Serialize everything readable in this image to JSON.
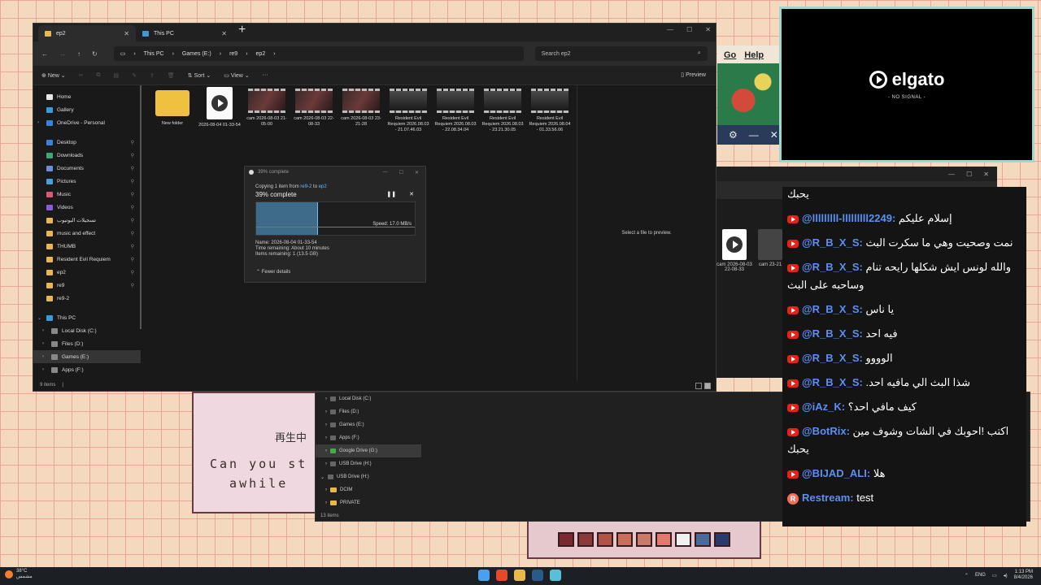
{
  "explorer": {
    "tabs": [
      {
        "label": "ep2",
        "close": "✕"
      },
      {
        "label": "This PC",
        "close": "✕"
      }
    ],
    "new_tab": "+",
    "window_controls": [
      "—",
      "☐",
      "✕"
    ],
    "breadcrumb": [
      "This PC",
      "Games (E:)",
      "re9",
      "ep2"
    ],
    "search_placeholder": "Search ep2",
    "toolbar": {
      "new": "New",
      "sort": "Sort",
      "view": "View",
      "more": "···",
      "preview": "Preview"
    },
    "nav": {
      "home": "Home",
      "gallery": "Gallery",
      "onedrive": "OneDrive - Personal",
      "quick": [
        {
          "label": "Desktop",
          "color": "#3b82d6"
        },
        {
          "label": "Downloads",
          "color": "#3aa87a"
        },
        {
          "label": "Documents",
          "color": "#6d8fd8"
        },
        {
          "label": "Pictures",
          "color": "#4a9fd8"
        },
        {
          "label": "Music",
          "color": "#e0567a"
        },
        {
          "label": "Videos",
          "color": "#8a5ad8"
        },
        {
          "label": "تسجيلات اليوتيوب",
          "color": "#e8b84a"
        },
        {
          "label": "music and effect",
          "color": "#e8b84a"
        },
        {
          "label": "THUMB",
          "color": "#e8b84a"
        },
        {
          "label": "Resident Evil Requiem",
          "color": "#e8b84a"
        },
        {
          "label": "ep2",
          "color": "#e8b84a"
        },
        {
          "label": "re9",
          "color": "#e8b84a"
        },
        {
          "label": "re9-2",
          "color": "#e8b84a"
        }
      ],
      "this_pc": "This PC",
      "drives": [
        "Local Disk (C:)",
        "Files (D:)",
        "Games (E:)",
        "Apps (F:)"
      ]
    },
    "files": [
      {
        "name": "New folder",
        "kind": "folder"
      },
      {
        "name": "2026-08-04 01-33-54",
        "kind": "video-doc"
      },
      {
        "name": "cam 2026-08-03 21-05-00",
        "kind": "face"
      },
      {
        "name": "cam 2026-08-03 22-08-33",
        "kind": "face"
      },
      {
        "name": "cam 2026-08-03 23-21-28",
        "kind": "face"
      },
      {
        "name": "Resident Evil Requiem 2026.08.03 - 21.07.46.03",
        "kind": "dark"
      },
      {
        "name": "Resident Evil Requiem 2026.08.03 - 22.08.34.04",
        "kind": "dark"
      },
      {
        "name": "Resident Evil Requiem 2026.08.03 - 23.21.30.05",
        "kind": "dark"
      },
      {
        "name": "Resident Evil Requiem 2026.08.04 - 01.33.56.06",
        "kind": "dark"
      }
    ],
    "preview_text": "Select a file to preview.",
    "status": "9 items"
  },
  "copy_dialog": {
    "title": "39% complete",
    "copying_prefix": "Copying 1 item from ",
    "from": "re9-2",
    "to_word": " to ",
    "to": "ep2",
    "percent_label": "39% complete",
    "progress": 0.39,
    "pause": "❚❚",
    "cancel": "✕",
    "speed": "Speed: 17.0 MB/s",
    "name": "Name: 2026-08-04 01-33-54",
    "time": "Time remaining:  About 10 minutes",
    "items": "Items remaining:  1 (13.5 GB)",
    "fewer": "Fewer details"
  },
  "explorer2": {
    "tree": [
      "Local Disk (C:)",
      "Files (D:)",
      "Games (E:)",
      "Apps (F:)",
      "Google Drive (G:)",
      "USB Drive (H:)",
      "USB Drive (H:)",
      "DCIM",
      "PRIVATE"
    ],
    "count": "13 items"
  },
  "right_files": [
    {
      "name": "cam 2026-08-03 22-08-33"
    },
    {
      "name": "cam 23-21"
    }
  ],
  "game": {
    "line1": "Can you st",
    "line2": "  awhile",
    "menu": [
      "Go",
      "Help"
    ],
    "kanji": "再生中"
  },
  "elgato": {
    "brand": "elgato",
    "status": "- NO SIGNAL -"
  },
  "chat": [
    {
      "src": "yt",
      "user": "",
      "text": "يحبك",
      "partial": true
    },
    {
      "src": "yt",
      "user": "@lllllllll-lllllllll2249:",
      "text": "إسلام عليكم"
    },
    {
      "src": "yt",
      "user": "@R_B_X_S:",
      "text": "نمت وصحيت وهي ما سكرت البث"
    },
    {
      "src": "yt",
      "user": "@R_B_X_S:",
      "text": "والله لونس ايش شكلها رايحه تنام",
      "text2": "وساحبه على البث"
    },
    {
      "src": "yt",
      "user": "@R_B_X_S:",
      "text": "يا ناس"
    },
    {
      "src": "yt",
      "user": "@R_B_X_S:",
      "text": "فيه احد"
    },
    {
      "src": "yt",
      "user": "@R_B_X_S:",
      "text": "الوووو"
    },
    {
      "src": "yt",
      "user": "@R_B_X_S:",
      "text": "شذا البث الي مافيه احد."
    },
    {
      "src": "yt",
      "user": "@iAz_K:",
      "text": "كيف مافي احد؟"
    },
    {
      "src": "yt",
      "user": "@BotRix:",
      "text": "اكتب !احوبك في الشات وشوف مين",
      "text2": "يحبك"
    },
    {
      "src": "yt",
      "user": "@BIJAD_ALI:",
      "text": "هلا"
    },
    {
      "src": "rs",
      "user": "Restream:",
      "text": "test"
    }
  ],
  "taskbar": {
    "temp": "38°C",
    "weather_sub": "مشمس",
    "lang": "ENG",
    "time": "1:13 PM",
    "date": "8/4/2026"
  }
}
